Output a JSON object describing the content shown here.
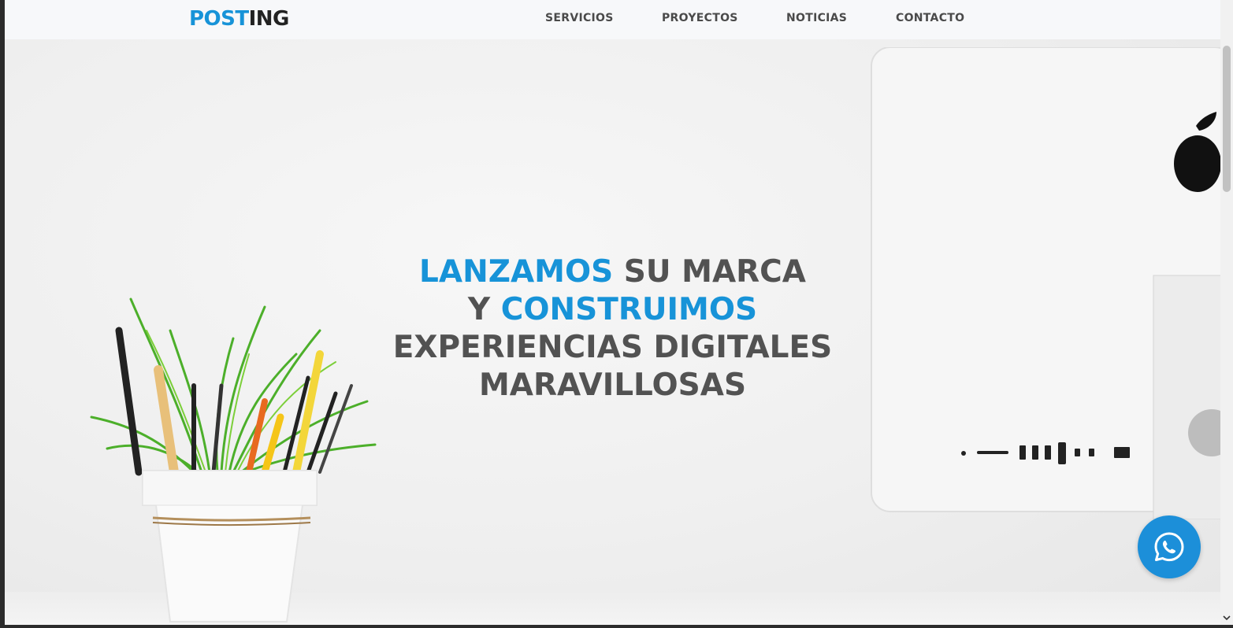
{
  "logo": {
    "part1": "POST",
    "part2": "ING"
  },
  "nav": {
    "items": [
      {
        "label": "SERVICIOS"
      },
      {
        "label": "PROYECTOS"
      },
      {
        "label": "NOTICIAS"
      },
      {
        "label": "CONTACTO"
      }
    ]
  },
  "hero": {
    "line1_accent": "LANZAMOS",
    "line1_rest": " SU MARCA",
    "line2_start": "Y ",
    "line2_accent": "CONSTRUIMOS",
    "line3": "EXPERIENCIAS DIGITALES",
    "line4": "MARAVILLOSAS"
  },
  "colors": {
    "accent": "#1793d8",
    "text_dark": "#525252",
    "nav_text": "#4a4a4a",
    "whatsapp_bg": "#1c8fd9"
  },
  "icons": {
    "whatsapp": "whatsapp-icon",
    "scroll_down": "chevron-down-icon"
  }
}
